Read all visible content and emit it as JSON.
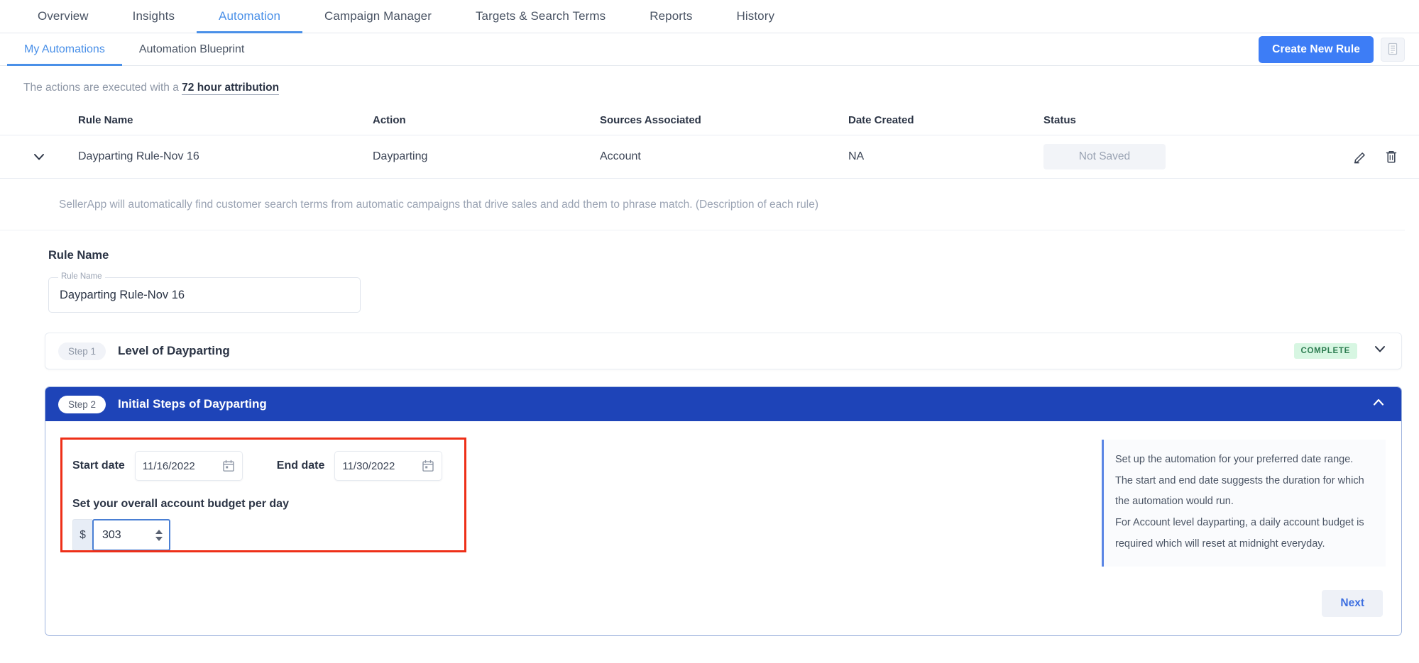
{
  "topnav": {
    "items": [
      {
        "label": "Overview",
        "active": false
      },
      {
        "label": "Insights",
        "active": false
      },
      {
        "label": "Automation",
        "active": true
      },
      {
        "label": "Campaign Manager",
        "active": false
      },
      {
        "label": "Targets & Search Terms",
        "active": false
      },
      {
        "label": "Reports",
        "active": false
      },
      {
        "label": "History",
        "active": false
      }
    ]
  },
  "subnav": {
    "items": [
      {
        "label": "My Automations",
        "active": true
      },
      {
        "label": "Automation Blueprint",
        "active": false
      }
    ],
    "create_button": "Create New Rule",
    "notes_icon": "document-icon"
  },
  "attribution": {
    "prefix": "The actions are executed with a ",
    "highlight": "72 hour attribution"
  },
  "table": {
    "headers": {
      "rule_name": "Rule Name",
      "action": "Action",
      "sources": "Sources Associated",
      "date_created": "Date Created",
      "status": "Status"
    },
    "rows": [
      {
        "rule_name": "Dayparting Rule-Nov 16",
        "action": "Dayparting",
        "sources": "Account",
        "date_created": "NA",
        "status": "Not Saved",
        "expanded": true
      }
    ]
  },
  "rule_description": "SellerApp will automatically find customer search terms from automatic campaigns that drive sales and add them to phrase match. (Description of each rule)",
  "rule_name_section": {
    "title": "Rule Name",
    "field_label": "Rule Name",
    "field_value": "Dayparting Rule-Nov 16",
    "field_placeholder": "Rule Name"
  },
  "step1": {
    "pill": "Step 1",
    "title": "Level of Dayparting",
    "status_badge": "COMPLETE",
    "chevron": "chevron-down-icon"
  },
  "step2": {
    "pill": "Step 2",
    "title": "Initial Steps of Dayparting",
    "chevron": "chevron-up-icon",
    "start_date_label": "Start date",
    "start_date_value": "11/16/2022",
    "end_date_label": "End date",
    "end_date_value": "11/30/2022",
    "budget_label": "Set your overall account budget per day",
    "currency_symbol": "$",
    "budget_value": "303",
    "help_line_1": "Set up the automation for your preferred date range. The start and end date suggests the duration for which the automation would run.",
    "help_line_2": "For Account level dayparting, a daily account budget is required which will reset at midnight everyday.",
    "next_button": "Next"
  },
  "colors": {
    "accent_blue": "#4a90e8",
    "primary_blue": "#3d7df6",
    "step2_header_blue": "#1e44b8",
    "complete_green_bg": "#d7f6e2",
    "complete_green_text": "#2e7d52",
    "annotation_red": "#ee2f18"
  }
}
